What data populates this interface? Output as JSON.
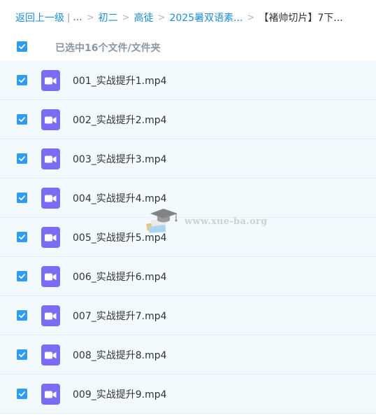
{
  "breadcrumb": {
    "back": "返回上一级",
    "divider": "|",
    "ellipsis": "...",
    "sep": ">",
    "items": [
      "初二",
      "高徒",
      "2025暑双语素..."
    ],
    "current": "【褚帅切片】7下..."
  },
  "selection": {
    "status": "已选中16个文件/文件夹"
  },
  "files": [
    {
      "name": "001_实战提升1.mp4"
    },
    {
      "name": "002_实战提升2.mp4"
    },
    {
      "name": "003_实战提升3.mp4"
    },
    {
      "name": "004_实战提升4.mp4"
    },
    {
      "name": "005_实战提升5.mp4"
    },
    {
      "name": "006_实战提升6.mp4"
    },
    {
      "name": "007_实战提升7.mp4"
    },
    {
      "name": "008_实战提升8.mp4"
    },
    {
      "name": "009_实战提升9.mp4"
    }
  ],
  "watermark": {
    "text": "www.xue-ba.org"
  },
  "colors": {
    "accent": "#2f9cf0",
    "link": "#1b8ddb",
    "video_icon": "#7b6cf2",
    "row_bg": "#f3fafd"
  },
  "icons": {
    "checkbox": "checkmark-icon",
    "file": "video-file-icon",
    "watermark": "graduation-cap-icon"
  }
}
